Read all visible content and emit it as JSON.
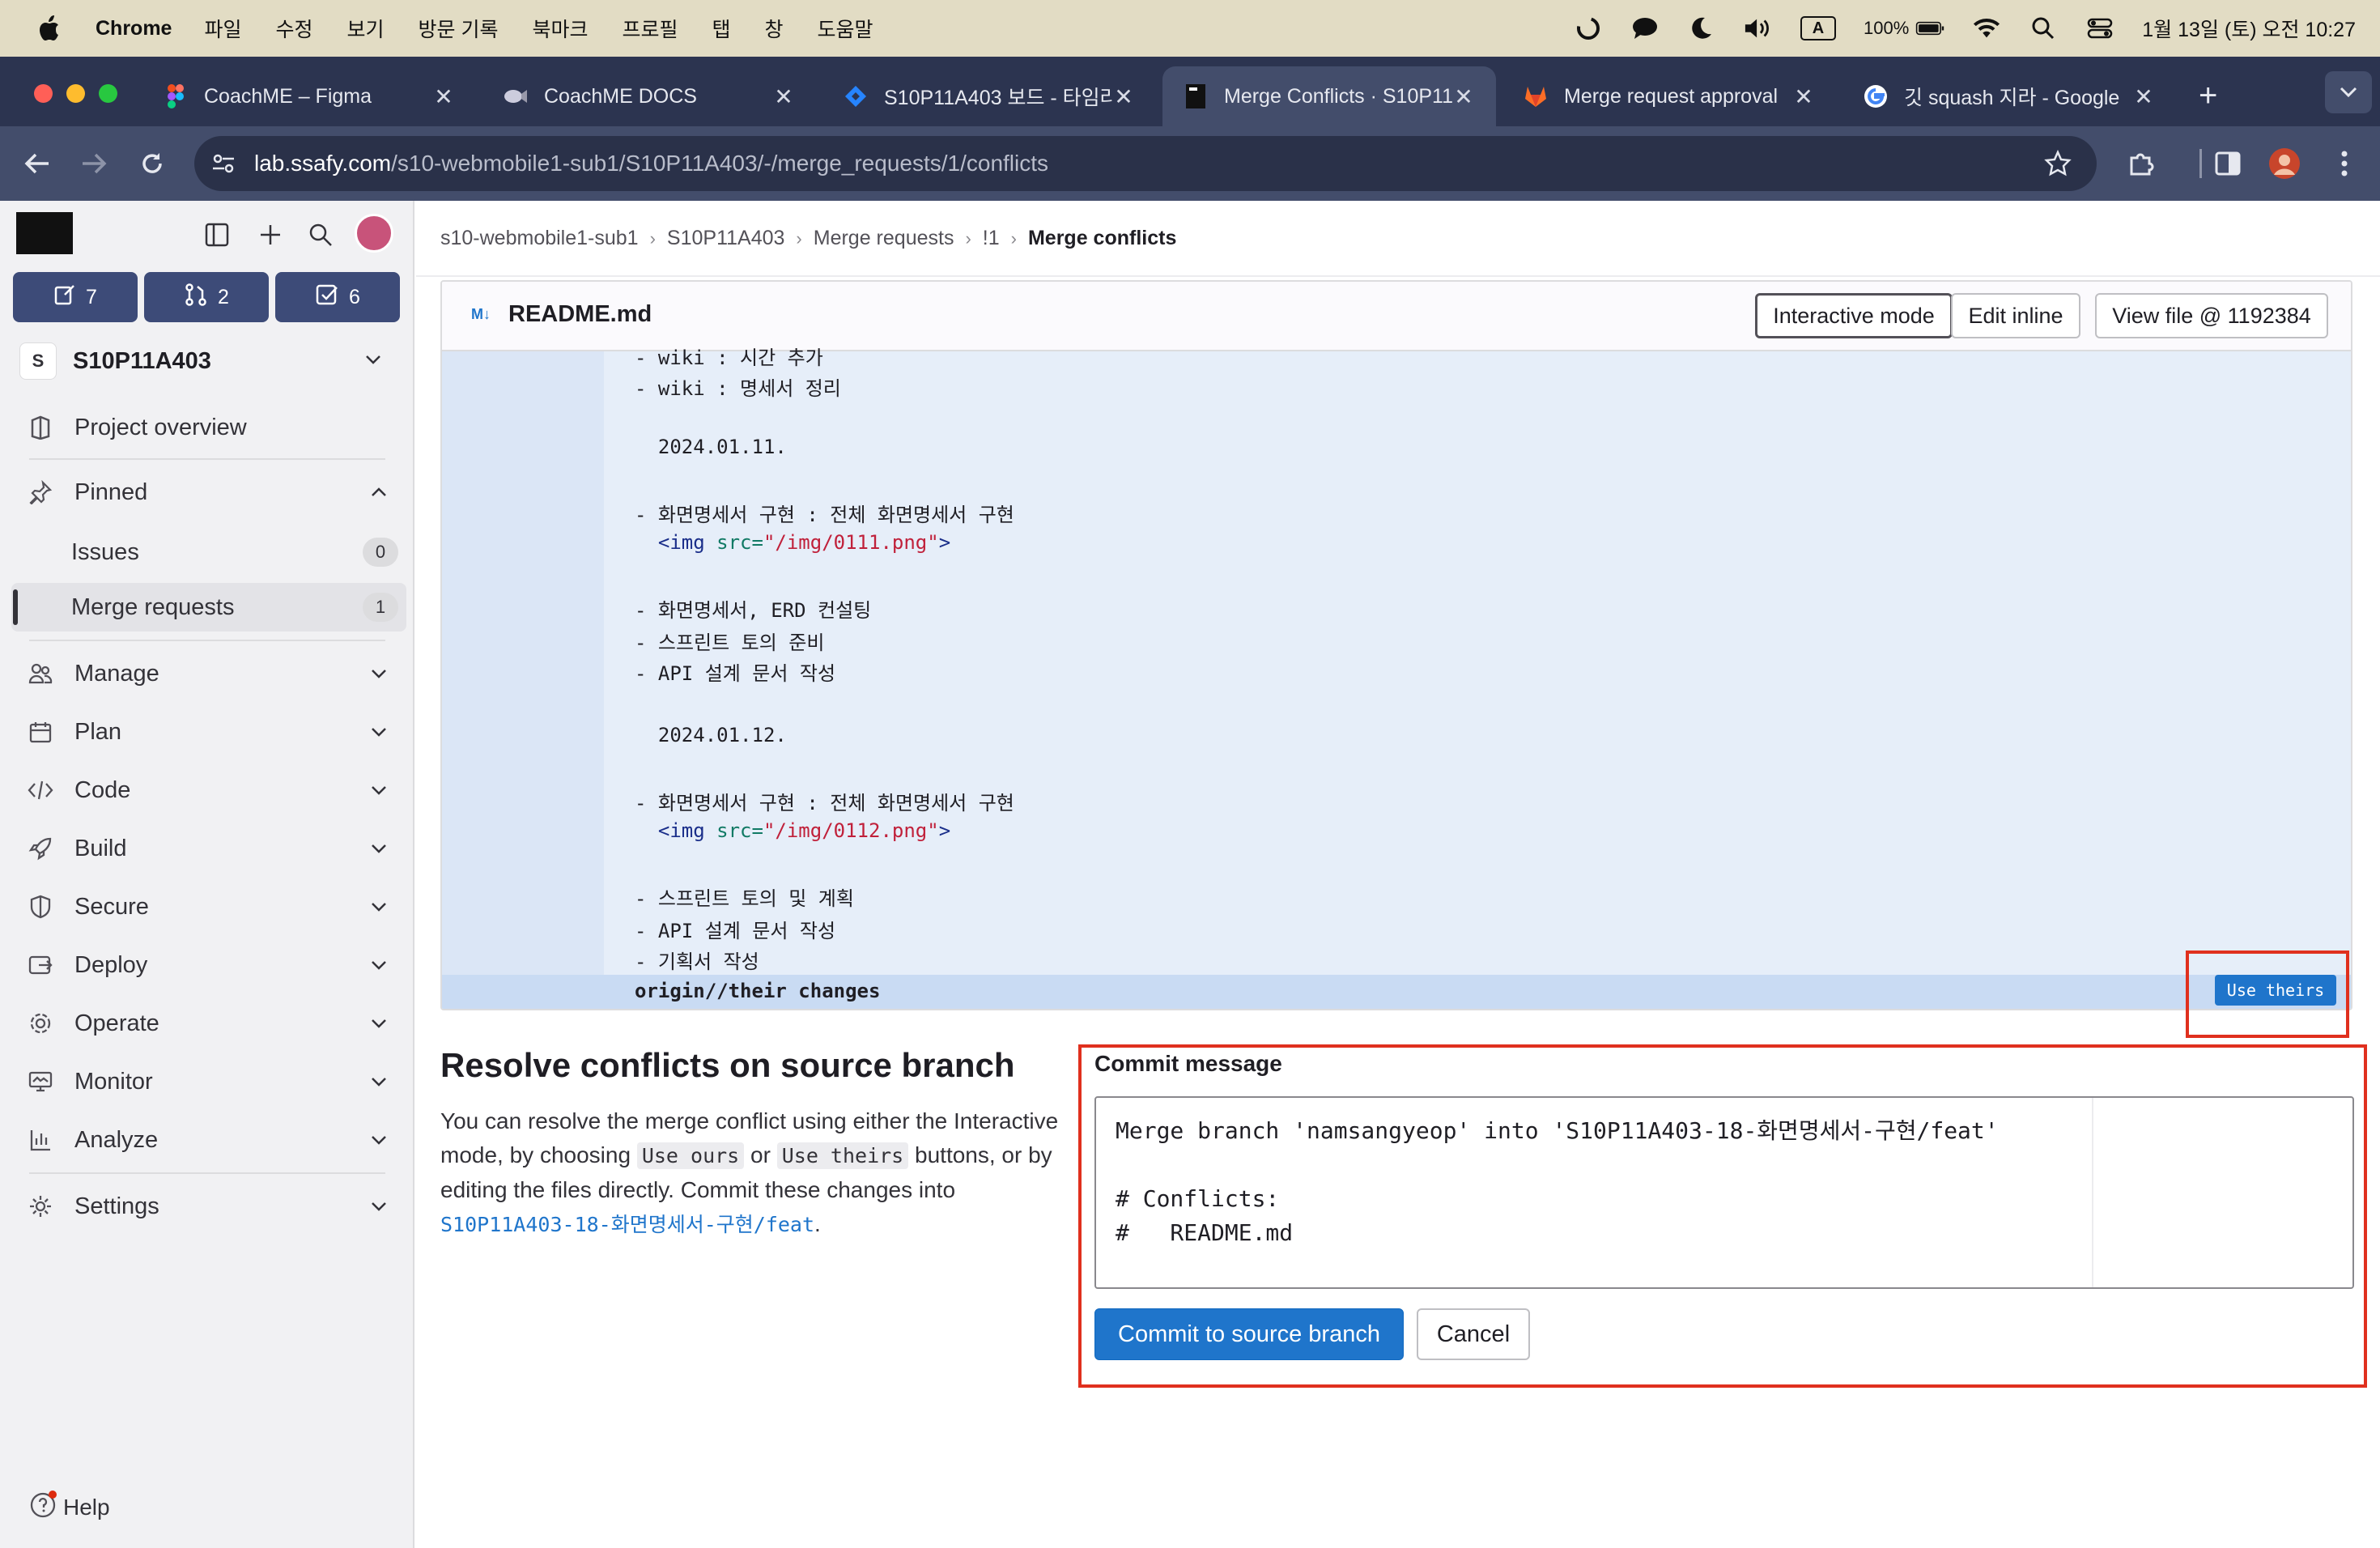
{
  "menubar": {
    "app_name": "Chrome",
    "menus": [
      "파일",
      "수정",
      "보기",
      "방문 기록",
      "북마크",
      "프로필",
      "탭",
      "창",
      "도움말"
    ],
    "battery": "100%",
    "datetime": "1월 13일 (토) 오전 10:27",
    "input_indicator": "A"
  },
  "tabs": [
    {
      "title": "CoachME – Figma",
      "icon": "figma-icon"
    },
    {
      "title": "CoachME DOCS",
      "icon": "docs-icon"
    },
    {
      "title": "S10P11A403 보드 - 타임라",
      "icon": "jira-icon"
    },
    {
      "title": "Merge Conflicts · S10P11",
      "icon": "gitlab-project-icon",
      "active": true
    },
    {
      "title": "Merge request approval",
      "icon": "gitlab-icon"
    },
    {
      "title": "깃 squash 지라 - Google",
      "icon": "google-icon"
    }
  ],
  "address_bar": {
    "host": "lab.ssafy.com",
    "path": "/s10-webmobile1-sub1/S10P11A403/-/merge_requests/1/conflicts"
  },
  "sidebar": {
    "counters": {
      "issues": "7",
      "merge_requests": "2",
      "todos": "6"
    },
    "project": {
      "initial": "S",
      "name": "S10P11A403"
    },
    "project_overview": "Project overview",
    "pinned": {
      "label": "Pinned",
      "items": [
        {
          "label": "Issues",
          "count": "0"
        },
        {
          "label": "Merge requests",
          "count": "1"
        }
      ]
    },
    "sections": [
      "Manage",
      "Plan",
      "Code",
      "Build",
      "Secure",
      "Deploy",
      "Operate",
      "Monitor",
      "Analyze"
    ],
    "settings": "Settings",
    "help": "Help"
  },
  "breadcrumb": [
    "s10-webmobile1-sub1",
    "S10P11A403",
    "Merge requests",
    "!1",
    "Merge conflicts"
  ],
  "file": {
    "md_badge": "M↓",
    "name": "README.md",
    "interactive_mode": "Interactive mode",
    "edit_inline": "Edit inline",
    "view_file": "View file @ 1192384"
  },
  "code_lines": [
    "- wiki : 시간 추가",
    "- wiki : 명세서 정리",
    "",
    "  2024.01.11.",
    "",
    "- 화면명세서 구현 : 전체 화면명세서 구현",
    "  <img src=\"/img/0111.png\">",
    "",
    "- 화면명세서, ERD 컨설팅",
    "- 스프린트 토의 준비",
    "- API 설계 문서 작성",
    "",
    "  2024.01.12.",
    "",
    "- 화면명세서 구현 : 전체 화면명세서 구현",
    "  <img src=\"/img/0112.png\">",
    "",
    "- 스프린트 토의 및 계획",
    "- API 설계 문서 작성",
    "- 기획서 작성"
  ],
  "img_lines": {
    "line1": {
      "tag": "<img",
      "attr": " src=",
      "value": "\"/img/0111.png\"",
      "close": ">"
    },
    "line2": {
      "tag": "<img",
      "attr": " src=",
      "value": "\"/img/0112.png\"",
      "close": ">"
    }
  },
  "their_changes_label": "origin//their changes",
  "use_theirs_label": "Use theirs",
  "resolve": {
    "title": "Resolve conflicts on source branch",
    "text_1": "You can resolve the merge conflict using either the Interactive mode, by choosing",
    "use_ours": "Use ours",
    "or": "or",
    "use_theirs": "Use theirs",
    "text_2": "buttons, or by editing the files directly. Commit these changes into",
    "branch": "S10P11A403-18-화면명세서-구현/feat",
    "period": "."
  },
  "commit": {
    "label": "Commit message",
    "message": "Merge branch 'namsangyeop' into 'S10P11A403-18-화면명세서-구현/feat'\n\n# Conflicts:\n#   README.md",
    "submit": "Commit to source branch",
    "cancel": "Cancel"
  }
}
